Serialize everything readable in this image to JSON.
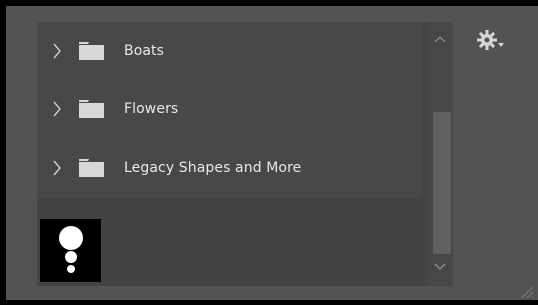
{
  "panel": {
    "items": [
      {
        "label": "Boats",
        "chevron_icon": "chevron-right-icon",
        "folder_icon": "folder-icon"
      },
      {
        "label": "Flowers",
        "chevron_icon": "chevron-right-icon",
        "folder_icon": "folder-icon"
      },
      {
        "label": "Legacy Shapes and More",
        "chevron_icon": "chevron-right-icon",
        "folder_icon": "folder-icon"
      }
    ]
  },
  "scroll": {
    "up_icon": "chevron-up-icon",
    "down_icon": "chevron-down-icon"
  },
  "settings": {
    "icon": "gear-icon",
    "dropdown_icon": "dropdown-caret-icon"
  },
  "colors": {
    "panel_bg": "#535353",
    "row_bg": "#484848",
    "text": "#e8e8e8",
    "icon": "#d6d6d6"
  }
}
